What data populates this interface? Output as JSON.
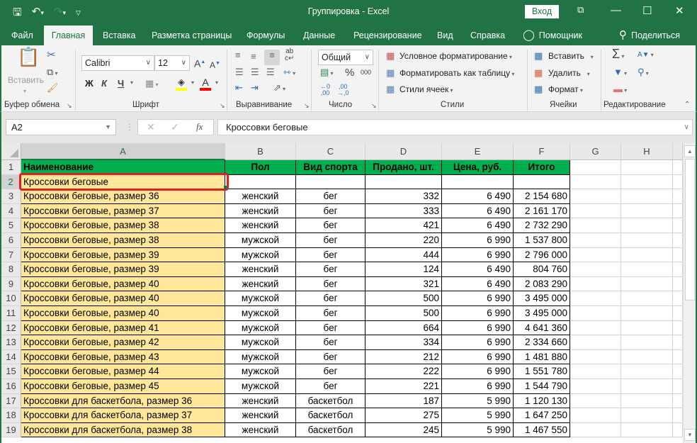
{
  "window": {
    "title": "Группировка  -  Excel",
    "login_label": "Вход",
    "qat": {
      "save_icon": "save-icon",
      "undo_icon": "undo-icon",
      "redo_icon": "redo-icon",
      "customize_icon": "customize-qat-icon"
    },
    "controls": {
      "ribbon_display": "⧉",
      "minimize": "—",
      "maximize": "☐",
      "close": "✕"
    }
  },
  "tabs": [
    {
      "label": "Файл"
    },
    {
      "label": "Главная",
      "active": true
    },
    {
      "label": "Вставка"
    },
    {
      "label": "Разметка страницы"
    },
    {
      "label": "Формулы"
    },
    {
      "label": "Данные"
    },
    {
      "label": "Рецензирование"
    },
    {
      "label": "Вид"
    },
    {
      "label": "Справка"
    },
    {
      "label": "Помощник"
    },
    {
      "label": "Поделиться"
    }
  ],
  "ribbon": {
    "clipboard": {
      "paste_label": "Вставить",
      "group_label": "Буфер обмена"
    },
    "font": {
      "font_name": "Calibri",
      "font_size": "12",
      "bold": "Ж",
      "italic": "К",
      "underline": "Ч",
      "group_label": "Шрифт",
      "fill_color": "#ffff00",
      "font_color": "#ff0000"
    },
    "alignment": {
      "group_label": "Выравнивание"
    },
    "number": {
      "format": "Общий",
      "percent": "%",
      "thousands": "000",
      "group_label": "Число"
    },
    "styles": {
      "conditional": "Условное форматирование",
      "as_table": "Форматировать как таблицу",
      "cell_styles": "Стили ячеек",
      "group_label": "Стили"
    },
    "cells": {
      "insert": "Вставить",
      "delete": "Удалить",
      "format": "Формат",
      "group_label": "Ячейки"
    },
    "editing": {
      "group_label": "Редактирование"
    }
  },
  "formula_bar": {
    "name_box": "A2",
    "fx_label": "fx",
    "value": "Кроссовки беговые"
  },
  "sheet": {
    "columns": [
      "A",
      "B",
      "C",
      "D",
      "E",
      "F",
      "G",
      "H"
    ],
    "selected_cell": "A2",
    "colors": {
      "header_fill": "#00b050",
      "name_fill": "#ffe699",
      "selection": "#217346",
      "highlight": "#e02020"
    },
    "header_row": [
      "Наименование",
      "Пол",
      "Вид спорта",
      "Продано, шт.",
      "Цена, руб.",
      "Итого"
    ],
    "rows": [
      {
        "num": "2",
        "cells": [
          "Кроссовки беговые",
          "",
          "",
          "",
          "",
          ""
        ]
      },
      {
        "num": "3",
        "cells": [
          "Кроссовки беговые, размер 36",
          "женский",
          "бег",
          "332",
          "6 490",
          "2 154 680"
        ]
      },
      {
        "num": "4",
        "cells": [
          "Кроссовки беговые, размер 37",
          "женский",
          "бег",
          "333",
          "6 490",
          "2 161 170"
        ]
      },
      {
        "num": "5",
        "cells": [
          "Кроссовки беговые, размер 38",
          "женский",
          "бег",
          "421",
          "6 490",
          "2 732 290"
        ]
      },
      {
        "num": "6",
        "cells": [
          "Кроссовки беговые, размер 38",
          "мужской",
          "бег",
          "220",
          "6 990",
          "1 537 800"
        ]
      },
      {
        "num": "7",
        "cells": [
          "Кроссовки беговые, размер 39",
          "мужской",
          "бег",
          "444",
          "6 990",
          "2 796 000"
        ]
      },
      {
        "num": "8",
        "cells": [
          "Кроссовки беговые, размер 39",
          "женский",
          "бег",
          "124",
          "6 490",
          "804 760"
        ]
      },
      {
        "num": "9",
        "cells": [
          "Кроссовки беговые, размер 40",
          "женский",
          "бег",
          "321",
          "6 490",
          "2 083 290"
        ]
      },
      {
        "num": "10",
        "cells": [
          "Кроссовки беговые, размер 40",
          "мужской",
          "бег",
          "500",
          "6 990",
          "3 495 000"
        ]
      },
      {
        "num": "11",
        "cells": [
          "Кроссовки беговые, размер 40",
          "мужской",
          "бег",
          "500",
          "6 990",
          "3 495 000"
        ]
      },
      {
        "num": "12",
        "cells": [
          "Кроссовки беговые, размер 41",
          "мужской",
          "бег",
          "664",
          "6 990",
          "4 641 360"
        ]
      },
      {
        "num": "13",
        "cells": [
          "Кроссовки беговые, размер 42",
          "мужской",
          "бег",
          "334",
          "6 990",
          "2 334 660"
        ]
      },
      {
        "num": "14",
        "cells": [
          "Кроссовки беговые, размер 43",
          "мужской",
          "бег",
          "212",
          "6 990",
          "1 481 880"
        ]
      },
      {
        "num": "15",
        "cells": [
          "Кроссовки беговые, размер 44",
          "мужской",
          "бег",
          "222",
          "6 990",
          "1 551 780"
        ]
      },
      {
        "num": "16",
        "cells": [
          "Кроссовки беговые, размер 45",
          "мужской",
          "бег",
          "221",
          "6 990",
          "1 544 790"
        ]
      },
      {
        "num": "17",
        "cells": [
          "Кроссовки для баскетбола, размер 36",
          "женский",
          "баскетбол",
          "187",
          "5 990",
          "1 120 130"
        ]
      },
      {
        "num": "18",
        "cells": [
          "Кроссовки для баскетбола, размер 37",
          "женский",
          "баскетбол",
          "275",
          "5 990",
          "1 647 250"
        ]
      },
      {
        "num": "19",
        "cells": [
          "Кроссовки для баскетбола, размер 38",
          "женский",
          "баскетбол",
          "245",
          "5 990",
          "1 467 550"
        ]
      }
    ]
  }
}
